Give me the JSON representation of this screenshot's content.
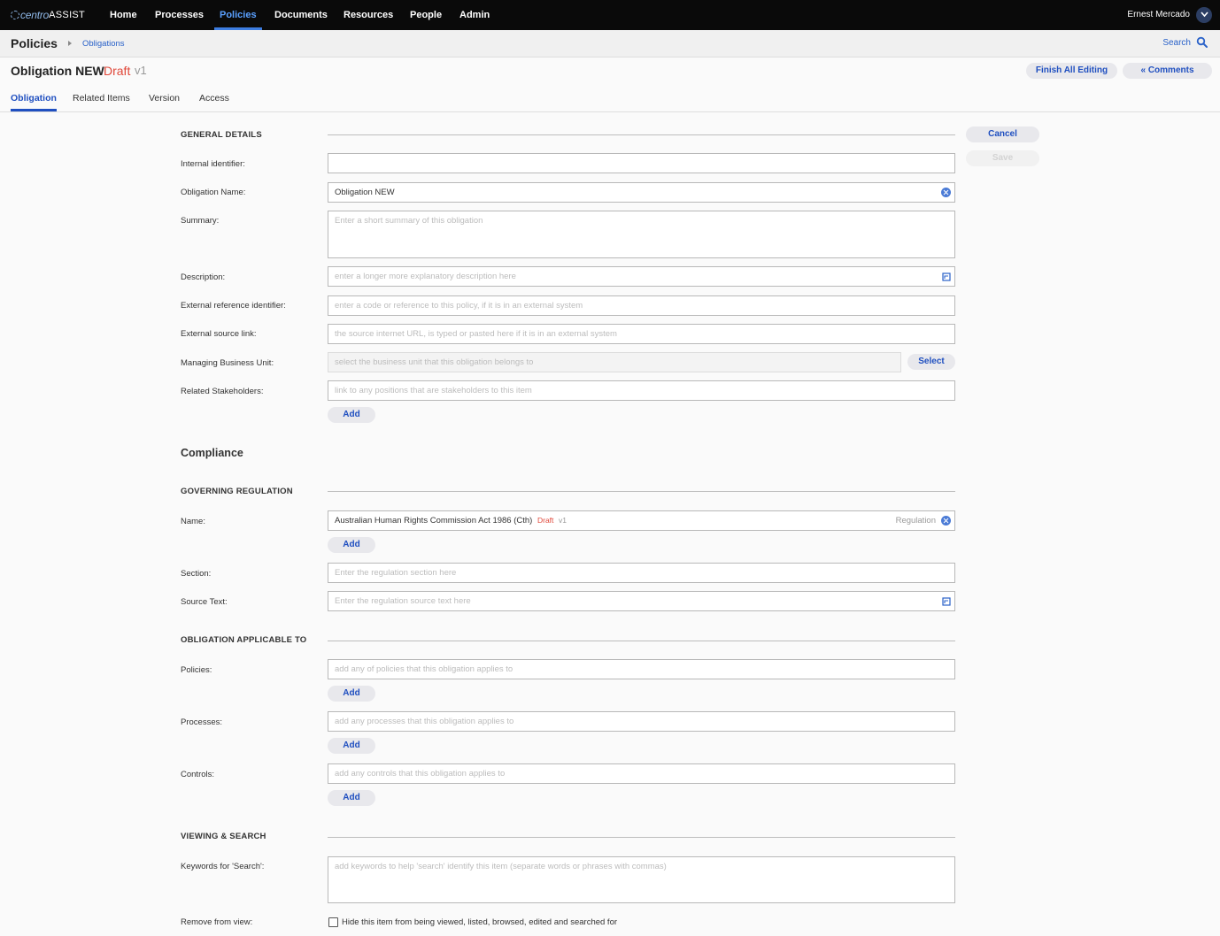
{
  "app": {
    "logo_centro": "centro",
    "logo_assist": "ASSIST",
    "nav": [
      "Home",
      "Processes",
      "Policies",
      "Documents",
      "Resources",
      "People",
      "Admin"
    ],
    "active_nav": "Policies",
    "user": "Ernest Mercado"
  },
  "breadcrumb": {
    "title": "Policies",
    "link": "Obligations",
    "search": "Search"
  },
  "item": {
    "name": "Obligation NEW",
    "status": "Draft",
    "version": "v1"
  },
  "actions": {
    "finish": "Finish All Editing",
    "comments": "Comments",
    "cancel": "Cancel",
    "save": "Save"
  },
  "tabs": [
    "Obligation",
    "Related Items",
    "Version",
    "Access"
  ],
  "active_tab": "Obligation",
  "general": {
    "heading": "GENERAL DETAILS",
    "internal_identifier": {
      "label": "Internal identifier:",
      "value": ""
    },
    "obligation_name": {
      "label": "Obligation Name:",
      "value": "Obligation NEW"
    },
    "summary": {
      "label": "Summary:",
      "placeholder": "Enter a short summary of this obligation"
    },
    "description": {
      "label": "Description:",
      "placeholder": "enter a longer more explanatory description here"
    },
    "external_ref": {
      "label": "External reference identifier:",
      "placeholder": "enter a code or reference to this policy, if it is in an external system"
    },
    "external_link": {
      "label": "External source link:",
      "placeholder": "the source internet URL, is typed or pasted here if it is in an external system"
    },
    "business_unit": {
      "label": "Managing Business Unit:",
      "placeholder": "select the business unit that this obligation belongs to",
      "button": "Select"
    },
    "stakeholders": {
      "label": "Related Stakeholders:",
      "placeholder": "link to any positions that are stakeholders to this item",
      "button": "Add"
    }
  },
  "compliance": {
    "title": "Compliance",
    "regulation_heading": "GOVERNING REGULATION",
    "name": {
      "label": "Name:",
      "value": "Australian Human Rights Commission Act 1986 (Cth)",
      "status": "Draft",
      "version": "v1",
      "tag": "Regulation",
      "button": "Add"
    },
    "section": {
      "label": "Section:",
      "placeholder": "Enter the regulation section here"
    },
    "source_text": {
      "label": "Source Text:",
      "placeholder": "Enter the regulation source text here"
    },
    "applicable_heading": "OBLIGATION APPLICABLE TO",
    "policies": {
      "label": "Policies:",
      "placeholder": "add any of policies that this obligation applies to",
      "button": "Add"
    },
    "processes": {
      "label": "Processes:",
      "placeholder": "add any processes that this obligation applies to",
      "button": "Add"
    },
    "controls": {
      "label": "Controls:",
      "placeholder": "add any controls that this obligation applies to",
      "button": "Add"
    }
  },
  "viewing": {
    "heading": "VIEWING & SEARCH",
    "keywords": {
      "label": "Keywords for 'Search':",
      "placeholder": "add keywords to help 'search' identify this item (separate words or phrases with commas)"
    },
    "remove": {
      "label": "Remove from view:",
      "checkbox_label": "Hide this item from being viewed, listed, browsed, edited and searched for",
      "checked": false
    }
  }
}
